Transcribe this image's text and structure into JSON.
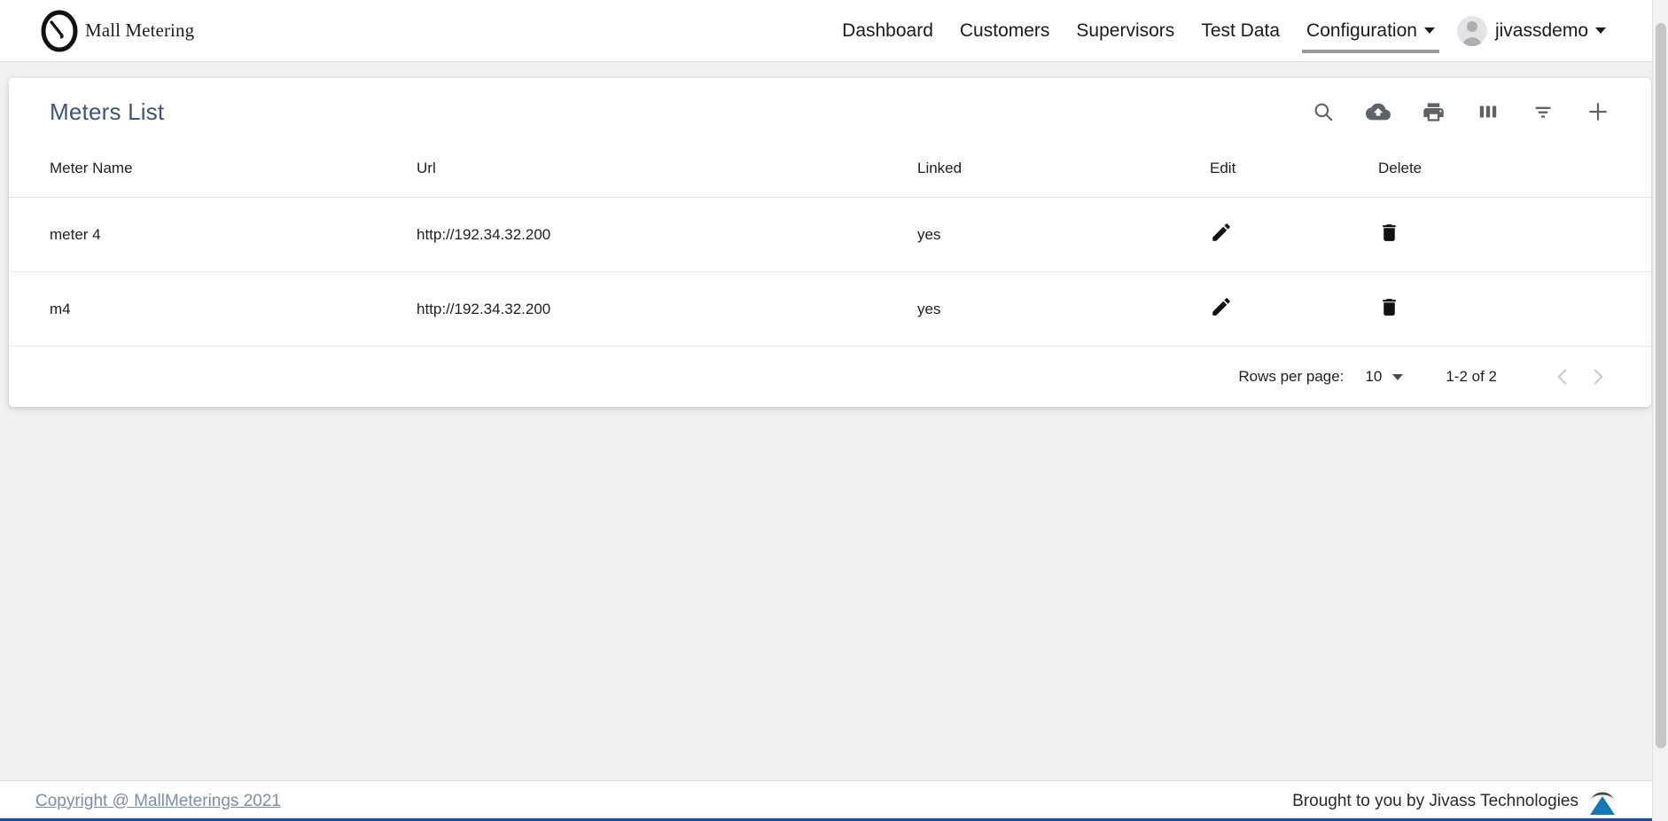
{
  "brand": {
    "name": "Mall Metering",
    "logo_icon": "gauge-meter-icon"
  },
  "nav": {
    "items": [
      {
        "label": "Dashboard",
        "active": false,
        "has_caret": false
      },
      {
        "label": "Customers",
        "active": false,
        "has_caret": false
      },
      {
        "label": "Supervisors",
        "active": false,
        "has_caret": false
      },
      {
        "label": "Test Data",
        "active": false,
        "has_caret": false
      },
      {
        "label": "Configuration",
        "active": true,
        "has_caret": true
      }
    ],
    "user": {
      "name": "jivassdemo",
      "avatar_icon": "user-avatar-icon",
      "caret_icon": "chevron-down-icon"
    }
  },
  "card": {
    "title": "Meters List",
    "toolbar": [
      {
        "name": "search-icon",
        "label": "Search"
      },
      {
        "name": "cloud-download-icon",
        "label": "Download"
      },
      {
        "name": "print-icon",
        "label": "Print"
      },
      {
        "name": "view-columns-icon",
        "label": "View Columns"
      },
      {
        "name": "filter-list-icon",
        "label": "Filter Table"
      },
      {
        "name": "add-icon",
        "label": "Add"
      }
    ]
  },
  "table": {
    "columns": [
      "Meter Name",
      "Url",
      "Linked",
      "Edit",
      "Delete"
    ],
    "rows": [
      {
        "meter_name": "meter 4",
        "url": "http://192.34.32.200",
        "linked": "yes",
        "edit_icon": "pencil-icon",
        "delete_icon": "trash-icon"
      },
      {
        "meter_name": "m4",
        "url": "http://192.34.32.200",
        "linked": "yes",
        "edit_icon": "pencil-icon",
        "delete_icon": "trash-icon"
      }
    ]
  },
  "paginator": {
    "rows_per_page_label": "Rows per page:",
    "rows_per_page_value": "10",
    "range_label": "1-2 of 2",
    "prev_icon": "chevron-left-icon",
    "next_icon": "chevron-right-icon"
  },
  "footer": {
    "copyright": "Copyright @ MallMeterings 2021",
    "credit": "Brought to you by Jivass Technologies",
    "credit_logo_icon": "jivass-logo-icon"
  },
  "colors": {
    "page_background": "#eff0f2",
    "card_background": "#ffffff",
    "title_accent": "#3f5577",
    "footer_link": "#7d8da6",
    "footer_rule": "#1b4f9c",
    "toolbar_icon": "#5f6368",
    "row_icon": "#111111",
    "nav_active_underline": "#9b9b9b"
  }
}
